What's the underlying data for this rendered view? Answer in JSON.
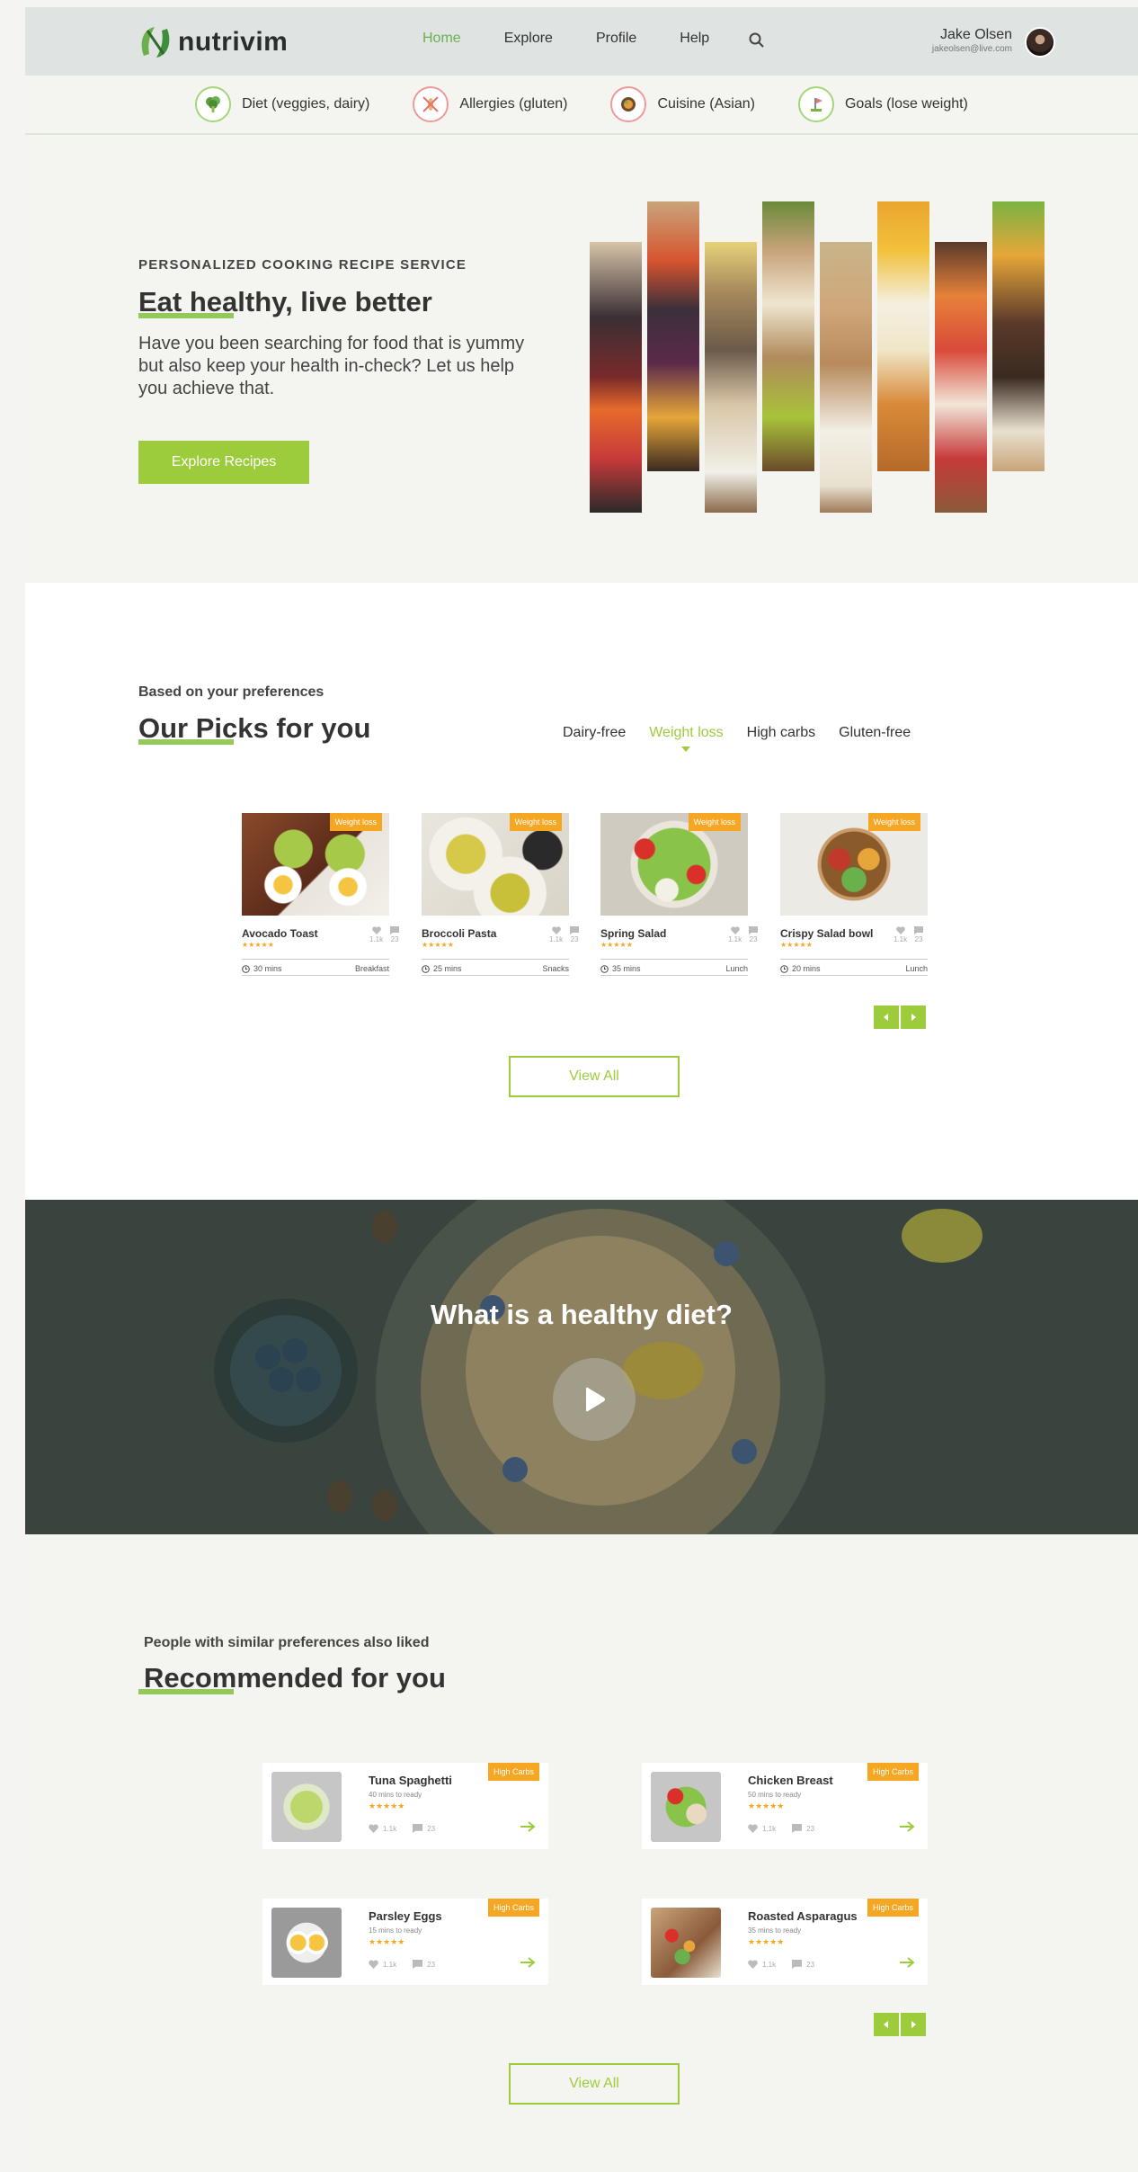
{
  "brand": {
    "name": "nutrivim"
  },
  "nav": {
    "items": [
      "Home",
      "Explore",
      "Profile",
      "Help"
    ],
    "active": "Home"
  },
  "user": {
    "name": "Jake Olsen",
    "email": "jakeolsen@live.com"
  },
  "preferences": [
    {
      "label": "Diet (veggies, dairy)",
      "icon": "broccoli-icon",
      "color": "#8bc34a"
    },
    {
      "label": "Allergies (gluten)",
      "icon": "no-gluten-icon",
      "color": "#e57373"
    },
    {
      "label": "Cuisine (Asian)",
      "icon": "bowl-icon",
      "color": "#e57373"
    },
    {
      "label": "Goals (lose weight)",
      "icon": "goal-icon",
      "color": "#8bc34a"
    }
  ],
  "hero": {
    "kicker": "PERSONALIZED COOKING RECIPE SERVICE",
    "title": "Eat healthy, live better",
    "text": "Have you been searching for food that is yummy but also keep your health in-check? Let us help you achieve that.",
    "cta": "Explore Recipes"
  },
  "picks": {
    "kicker": "Based on your preferences",
    "title": "Our Picks for you",
    "tabs": [
      "Dairy-free",
      "Weight loss",
      "High carbs",
      "Gluten-free"
    ],
    "active_tab": "Weight loss",
    "cards": [
      {
        "title": "Avocado Toast",
        "badge": "Weight loss",
        "likes": "1.1k",
        "comments": "23",
        "time": "30 mins",
        "category": "Breakfast",
        "stars": "★★★★★"
      },
      {
        "title": "Broccoli Pasta",
        "badge": "Weight loss",
        "likes": "1.1k",
        "comments": "23",
        "time": "25 mins",
        "category": "Snacks",
        "stars": "★★★★★"
      },
      {
        "title": "Spring Salad",
        "badge": "Weight loss",
        "likes": "1.1k",
        "comments": "23",
        "time": "35 mins",
        "category": "Lunch",
        "stars": "★★★★★"
      },
      {
        "title": "Crispy Salad bowl",
        "badge": "Weight loss",
        "likes": "1.1k",
        "comments": "23",
        "time": "20 mins",
        "category": "Lunch",
        "stars": "★★★★★"
      }
    ],
    "view_all": "View All"
  },
  "video": {
    "title": "What is a healthy diet?"
  },
  "recommended": {
    "kicker": "People with similar preferences also liked",
    "title": "Recommended for you",
    "cards": [
      {
        "title": "Tuna Spaghetti",
        "subtitle": "40 mins to ready",
        "badge": "High Carbs",
        "likes": "1.1k",
        "comments": "23",
        "stars": "★★★★★"
      },
      {
        "title": "Chicken Breast",
        "subtitle": "50 mins to ready",
        "badge": "High Carbs",
        "likes": "1.1k",
        "comments": "23",
        "stars": "★★★★★"
      },
      {
        "title": "Parsley Eggs",
        "subtitle": "15 mins to ready",
        "badge": "High Carbs",
        "likes": "1.1k",
        "comments": "23",
        "stars": "★★★★★"
      },
      {
        "title": "Roasted Asparagus",
        "subtitle": "35 mins to ready",
        "badge": "High Carbs",
        "likes": "1.1k",
        "comments": "23",
        "stars": "★★★★★"
      }
    ],
    "view_all": "View All"
  },
  "colors": {
    "accent": "#9ccc3b",
    "badge": "#f5a623",
    "header": "#dfe3e2",
    "background": "#f4f5f0"
  }
}
